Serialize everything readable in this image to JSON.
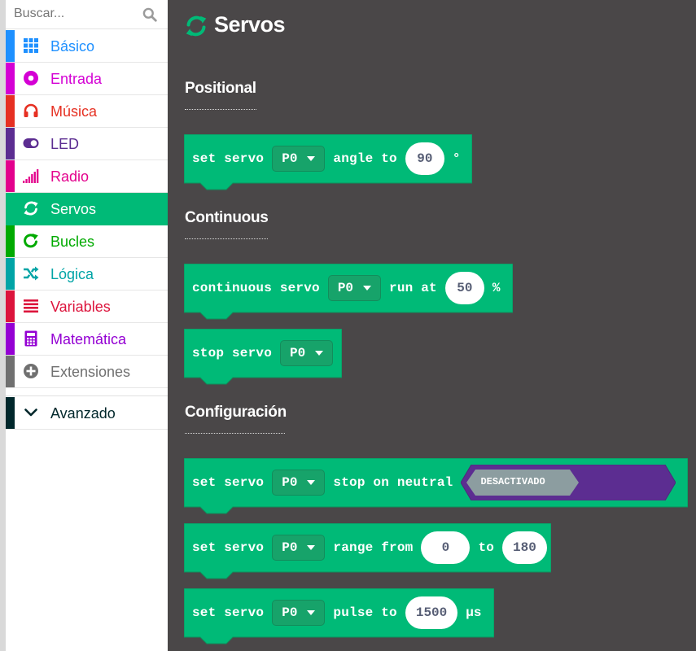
{
  "search": {
    "placeholder": "Buscar..."
  },
  "categories": [
    {
      "label": "Básico",
      "icon": "grid-icon",
      "color": "#1e90ff"
    },
    {
      "label": "Entrada",
      "icon": "target-circle-icon",
      "color": "#d400d4"
    },
    {
      "label": "Música",
      "icon": "headphones-icon",
      "color": "#e63022"
    },
    {
      "label": "LED",
      "icon": "toggle-switch-icon",
      "color": "#5c2d91"
    },
    {
      "label": "Radio",
      "icon": "signal-bars-icon",
      "color": "#e3008c"
    },
    {
      "label": "Servos",
      "icon": "refresh-arrows-icon",
      "color": "#00ba77",
      "selected": true
    },
    {
      "label": "Bucles",
      "icon": "loop-arrow-icon",
      "color": "#00aa00"
    },
    {
      "label": "Lógica",
      "icon": "shuffle-icon",
      "color": "#00a4a6"
    },
    {
      "label": "Variables",
      "icon": "list-lines-icon",
      "color": "#dc143c"
    },
    {
      "label": "Matemática",
      "icon": "calculator-icon",
      "color": "#9400d3"
    },
    {
      "label": "Extensiones",
      "icon": "plus-circle-icon",
      "color": "#707070"
    }
  ],
  "advanced": {
    "label": "Avanzado",
    "icon": "chevron-down-icon",
    "color": "#00272b"
  },
  "workspace": {
    "title": "Servos",
    "title_icon": "refresh-arrows-icon",
    "block_color": "#00ba77",
    "groups": {
      "positional": "Positional",
      "continuous": "Continuous",
      "config": "Configuración"
    }
  },
  "blocks": {
    "angle": {
      "kw1": "set servo",
      "pin": "P0",
      "kw2": "angle to",
      "value": "90",
      "unit": "°"
    },
    "continuous": {
      "kw1": "continuous servo",
      "pin": "P0",
      "kw2": "run at",
      "value": "50",
      "unit": "%"
    },
    "stop": {
      "kw1": "stop servo",
      "pin": "P0"
    },
    "neutral": {
      "kw1": "set servo",
      "pin": "P0",
      "kw2": "stop on neutral",
      "toggle": "DESACTIVADO",
      "toggle_off_color": "#8c9da0",
      "toggle_track_color": "#5c2d91"
    },
    "range": {
      "kw1": "set servo",
      "pin": "P0",
      "kw2": "range from",
      "from": "0",
      "kw3": "to",
      "to": "180"
    },
    "pulse": {
      "kw1": "set servo",
      "pin": "P0",
      "kw2": "pulse to",
      "value": "1500",
      "unit": "μs"
    }
  }
}
